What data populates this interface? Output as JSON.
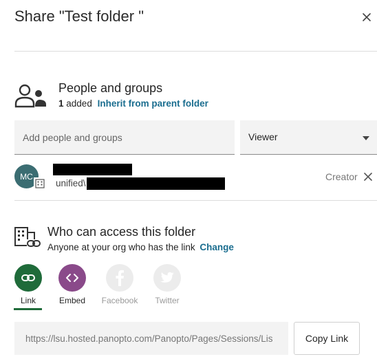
{
  "dialog": {
    "title": "Share \"Test folder \""
  },
  "people": {
    "heading": "People and groups",
    "count": "1",
    "count_suffix": "added",
    "inherit_link": "Inherit from parent folder",
    "add_placeholder": "Add people and groups",
    "role_selected": "Viewer"
  },
  "member": {
    "initials": "MC",
    "account_prefix": "unified\\",
    "role": "Creator"
  },
  "access": {
    "heading": "Who can access this folder",
    "description": "Anyone at your org who has the link",
    "change_link": "Change"
  },
  "share_options": [
    {
      "label": "Link",
      "color": "#1f6b3a",
      "active": true
    },
    {
      "label": "Embed",
      "color": "#8a4a8a",
      "active": false
    },
    {
      "label": "Facebook",
      "color": "#ececec",
      "active": false
    },
    {
      "label": "Twitter",
      "color": "#ececec",
      "active": false
    }
  ],
  "link": {
    "url": "https://lsu.hosted.panopto.com/Panopto/Pages/Sessions/Lis",
    "copy_label": "Copy Link"
  },
  "colors": {
    "accent_link": "#1a6d8f",
    "avatar": "#3b6d72",
    "link_green": "#1f6b3a",
    "embed_purple": "#8a4a8a"
  }
}
